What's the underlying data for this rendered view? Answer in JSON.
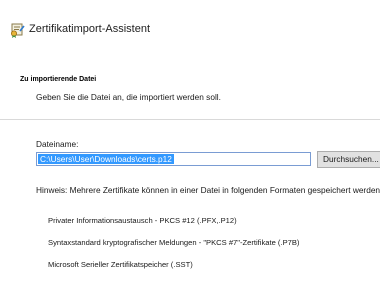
{
  "window": {
    "title": "Zertifikatimport-Assistent",
    "icon": "certificate-wizard-icon"
  },
  "header": {
    "heading": "Zu importierende Datei",
    "description": "Geben Sie die Datei an, die importiert werden soll."
  },
  "file": {
    "label": "Dateiname:",
    "value": "C:\\Users\\User\\Downloads\\certs.p12",
    "browse_label": "Durchsuchen..."
  },
  "hint": "Hinweis: Mehrere Zertifikate können in einer Datei in folgenden Formaten gespeichert werden:",
  "formats": [
    "Privater Informationsaustausch - PKCS #12 (.PFX,.P12)",
    "Syntaxstandard kryptografischer Meldungen - \"PKCS #7\"-Zertifikate (.P7B)",
    "Microsoft Serieller Zertifikatspeicher (.SST)"
  ],
  "colors": {
    "selection": "#3399ff",
    "input_border": "#7a9cd3",
    "button_face": "#e1e1e1"
  }
}
